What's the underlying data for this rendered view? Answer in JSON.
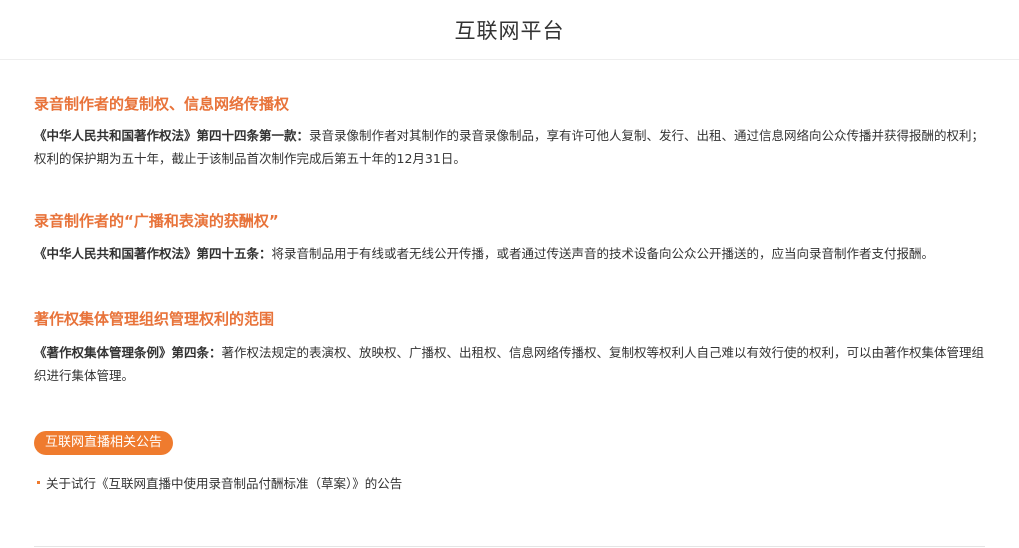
{
  "header": {
    "title": "互联网平台"
  },
  "sections": [
    {
      "title": "录音制作者的复制权、信息网络传播权",
      "law_ref": "《中华人民共和国著作权法》第四十四条第一款：",
      "text": "录音录像制作者对其制作的录音录像制品，享有许可他人复制、发行、出租、通过信息网络向公众传播并获得报酬的权利；权利的保护期为五十年，截止于该制品首次制作完成后第五十年的12月31日。"
    },
    {
      "title": "录音制作者的“广播和表演的获酬权”",
      "law_ref": "《中华人民共和国著作权法》第四十五条：",
      "text": "将录音制品用于有线或者无线公开传播，或者通过传送声音的技术设备向公众公开播送的，应当向录音制作者支付报酬。"
    },
    {
      "title": "著作权集体管理组织管理权利的范围",
      "law_ref": "《著作权集体管理条例》第四条：",
      "text": "著作权法规定的表演权、放映权、广播权、出租权、信息网络传播权、复制权等权利人自己难以有效行使的权利，可以由著作权集体管理组织进行集体管理。"
    }
  ],
  "notices": {
    "badge_label": "互联网直播相关公告",
    "items": [
      {
        "label": "关于试行《互联网直播中使用录音制品付酬标准（草案）》的公告"
      }
    ]
  },
  "colors": {
    "accent": "#ef7b2e",
    "section_title": "#e8733a",
    "text": "#333333"
  }
}
